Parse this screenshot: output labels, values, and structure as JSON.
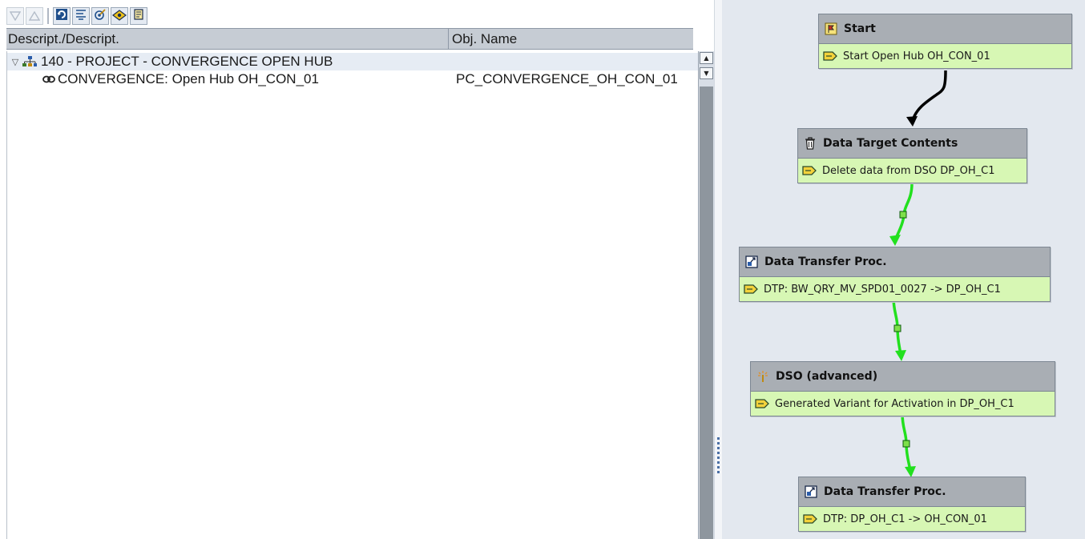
{
  "toolbar": {
    "buttons": [
      {
        "icon": "expand-all-icon",
        "enabled": false
      },
      {
        "icon": "collapse-all-icon",
        "enabled": false
      },
      {
        "icon": "refresh-icon",
        "enabled": true
      },
      {
        "icon": "filter-icon",
        "enabled": true
      },
      {
        "icon": "target-icon",
        "enabled": true
      },
      {
        "icon": "eye-icon",
        "enabled": true
      },
      {
        "icon": "document-icon",
        "enabled": true
      }
    ]
  },
  "tree": {
    "columns": [
      "Descript./Descript.",
      "Obj. Name"
    ],
    "root": {
      "label": "140 - PROJECT - CONVERGENCE OPEN HUB",
      "icon": "project-hierarchy-icon",
      "expanded": true
    },
    "children": [
      {
        "label": "CONVERGENCE: Open Hub OH_CON_01",
        "icon": "chain-link-icon",
        "obj_name": "PC_CONVERGENCE_OH_CON_01"
      }
    ]
  },
  "chain": {
    "nodes": [
      {
        "title": "Start",
        "title_icon": "start-flag-icon",
        "subtitle": "Start Open Hub OH_CON_01",
        "sub_icon": "variant-icon"
      },
      {
        "title": "Data Target Contents",
        "title_icon": "trash-icon",
        "subtitle": "Delete data from DSO DP_OH_C1",
        "sub_icon": "variant-icon"
      },
      {
        "title": "Data Transfer Proc.",
        "title_icon": "dtp-icon",
        "subtitle": "DTP: BW_QRY_MV_SPD01_0027 -> DP_OH_C1",
        "sub_icon": "variant-icon"
      },
      {
        "title": "DSO (advanced)",
        "title_icon": "activation-wand-icon",
        "subtitle": "Generated Variant for Activation in DP_OH_C1",
        "sub_icon": "variant-icon"
      },
      {
        "title": "Data Transfer Proc.",
        "title_icon": "dtp-icon",
        "subtitle": "DTP: DP_OH_C1 -> OH_CON_01",
        "sub_icon": "variant-icon"
      }
    ],
    "links": [
      {
        "from": 0,
        "to": 1,
        "type": "always",
        "color": "#000000"
      },
      {
        "from": 1,
        "to": 2,
        "type": "success",
        "color": "#22e01e"
      },
      {
        "from": 2,
        "to": 3,
        "type": "success",
        "color": "#22e01e"
      },
      {
        "from": 3,
        "to": 4,
        "type": "success",
        "color": "#22e01e"
      }
    ]
  },
  "colors": {
    "node_header": "#a9aeb4",
    "node_body": "#d7f7b4",
    "canvas": "#e3e8ef",
    "success_link": "#22e01e"
  }
}
